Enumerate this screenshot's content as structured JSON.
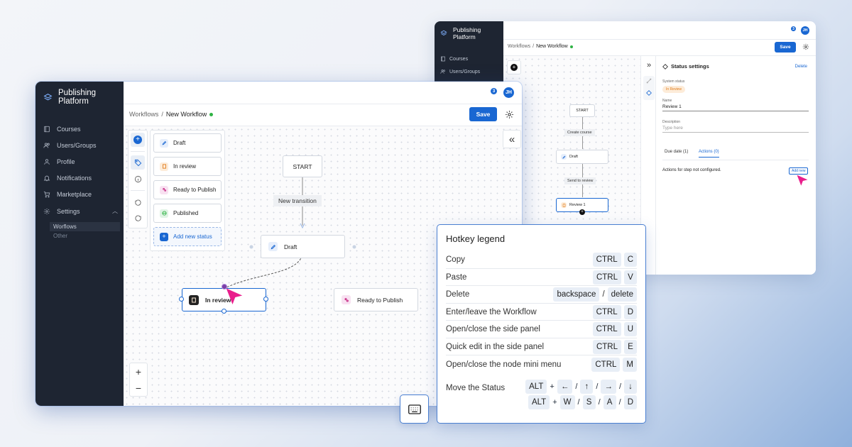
{
  "brand": {
    "name": "Publishing Platform"
  },
  "notifications": {
    "count": "3"
  },
  "user": {
    "initials": "JH"
  },
  "breadcrumb": {
    "root": "Workflows",
    "separator": "/",
    "current": "New Workflow"
  },
  "toolbar": {
    "save_label": "Save"
  },
  "sidebar": {
    "items": [
      {
        "label": "Courses",
        "icon": "book-icon"
      },
      {
        "label": "Users/Groups",
        "icon": "users-icon"
      },
      {
        "label": "Profile",
        "icon": "person-icon"
      },
      {
        "label": "Notifications",
        "icon": "bell-icon"
      },
      {
        "label": "Marketplace",
        "icon": "cart-icon"
      },
      {
        "label": "Settings",
        "icon": "gear-icon"
      }
    ],
    "sub_items": [
      {
        "label": "Worflows"
      },
      {
        "label": "Other"
      }
    ]
  },
  "status_palette": {
    "items": [
      {
        "label": "Draft",
        "icon": "pencil-icon"
      },
      {
        "label": "In review",
        "icon": "document-icon"
      },
      {
        "label": "Ready to Publish",
        "icon": "users-icon"
      },
      {
        "label": "Published",
        "icon": "globe-icon"
      }
    ],
    "add_label": "Add new status"
  },
  "canvas": {
    "start_label": "START",
    "transition_label": "New transition",
    "nodes": {
      "draft": "Draft",
      "in_review": "In review",
      "ready": "Ready to Publish"
    }
  },
  "collapse_label": "«",
  "zoom": {
    "in": "+",
    "out": "−"
  },
  "back_window": {
    "nav": [
      {
        "label": "Courses"
      },
      {
        "label": "Users/Groups"
      }
    ],
    "expand_label": "»",
    "flow": {
      "start": "START",
      "t1": "Create course",
      "draft": "Draft",
      "t2": "Send to review",
      "review": "Review 1"
    },
    "panel": {
      "title": "Status settings",
      "delete_label": "Delete",
      "system_status_label": "System status",
      "system_status_value": "In Review",
      "name_label": "Name",
      "name_value": "Review 1",
      "description_label": "Description",
      "description_placeholder": "Type here",
      "tabs": [
        "Due date (1)",
        "Actions (0)"
      ],
      "empty_text": "Actions for step not configured.",
      "add_new_label": "Add new"
    }
  },
  "hotkeys": {
    "title": "Hotkey legend",
    "rows": [
      {
        "label": "Copy",
        "keys": [
          "CTRL",
          "C"
        ]
      },
      {
        "label": "Paste",
        "keys": [
          "CTRL",
          "V"
        ]
      },
      {
        "label": "Delete",
        "keys": [
          "backspace",
          "/",
          "delete"
        ]
      },
      {
        "label": "Enter/leave the Workflow",
        "keys": [
          "CTRL",
          "D"
        ]
      },
      {
        "label": "Open/close the side panel",
        "keys": [
          "CTRL",
          "U"
        ]
      },
      {
        "label": "Quick edit in the side panel",
        "keys": [
          "CTRL",
          "E"
        ]
      },
      {
        "label": "Open/close the node mini menu",
        "keys": [
          "CTRL",
          "M"
        ]
      }
    ],
    "move": {
      "label": "Move the Status",
      "row1": [
        "ALT",
        "+",
        "←",
        "/",
        "↑",
        "/",
        "→",
        "/",
        "↓"
      ],
      "row2": [
        "ALT",
        "+",
        "W",
        "/",
        "S",
        "/",
        "A",
        "/",
        "D"
      ]
    }
  },
  "colors": {
    "accent": "#1967d2",
    "sidebar": "#1e2532",
    "pointer": "#e91e8c",
    "status_green": "#2fb344",
    "draft_bg": "#e6eefb",
    "review_bg": "#fdecd9",
    "ready_bg": "#f8e1f1",
    "published_bg": "#dff3e4"
  }
}
